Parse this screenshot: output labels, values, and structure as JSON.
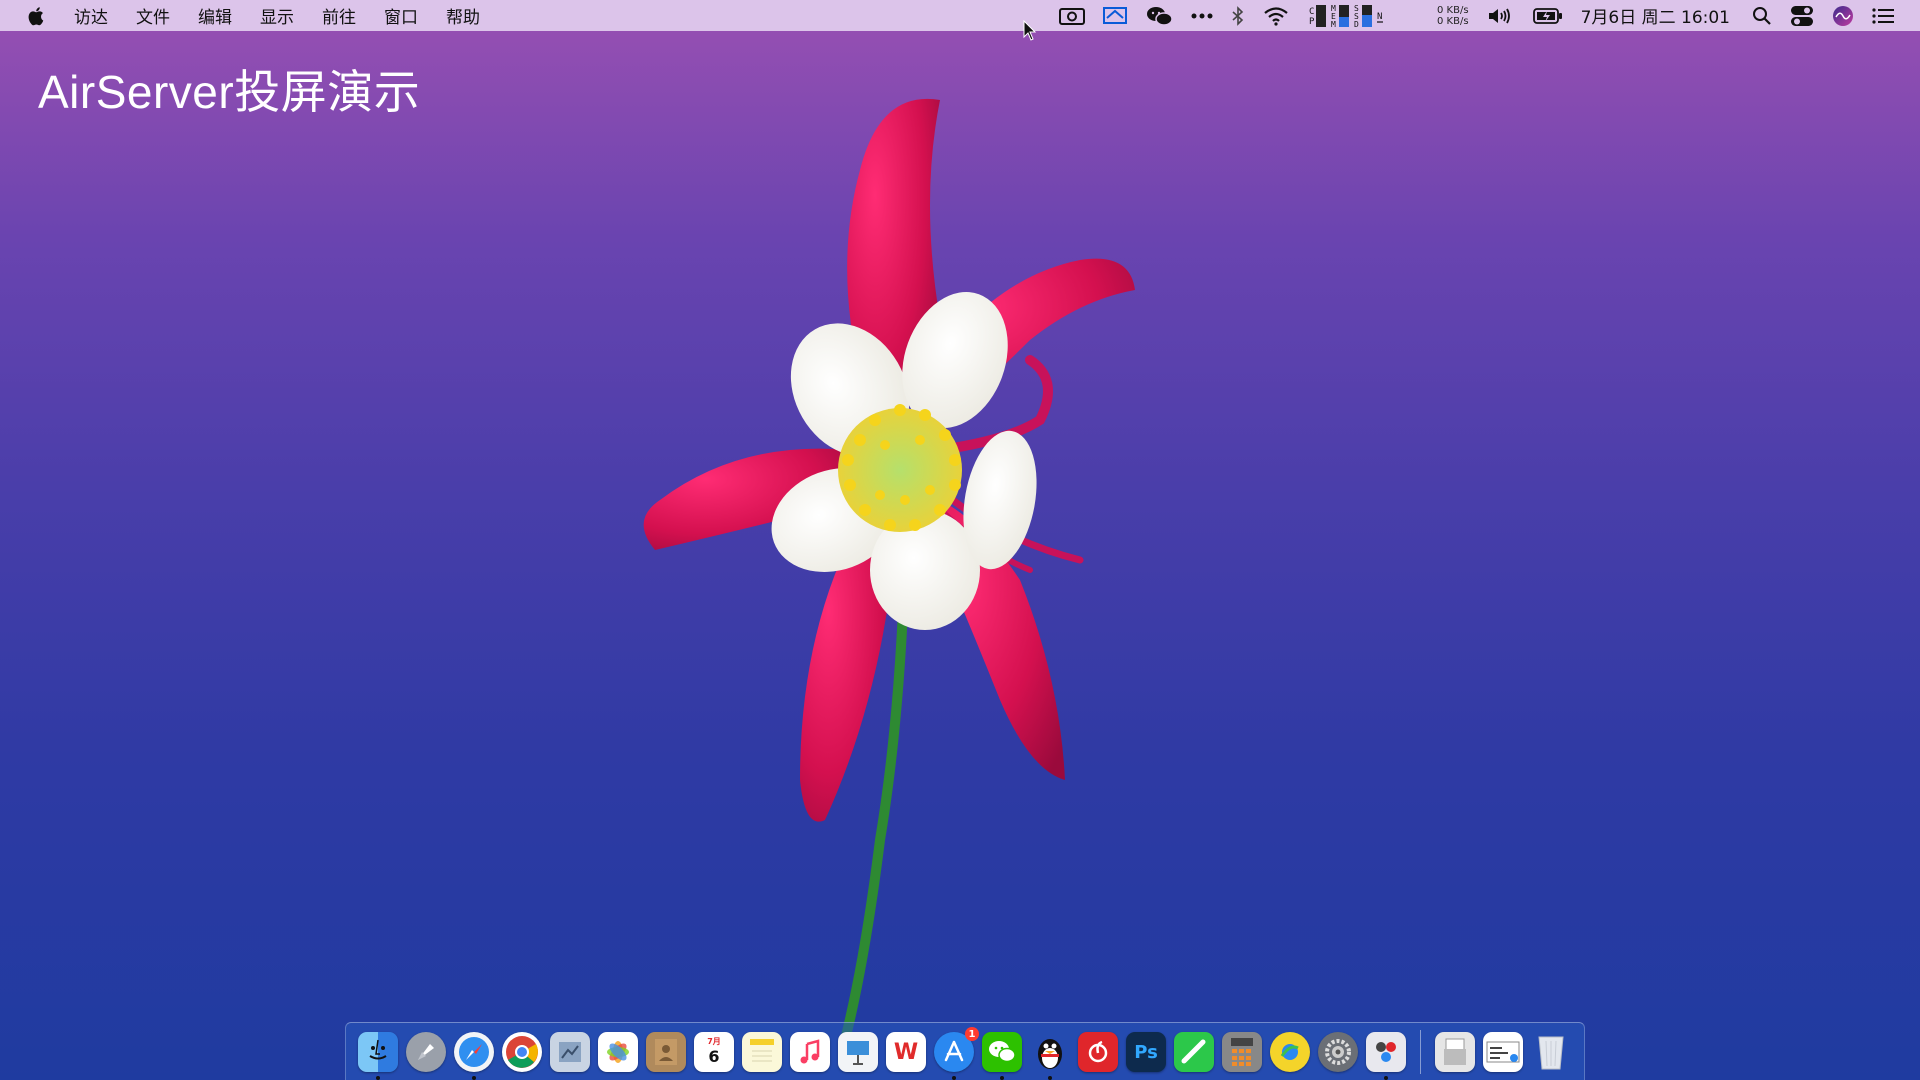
{
  "menubar": {
    "app_menus": [
      "访达",
      "文件",
      "编辑",
      "显示",
      "前往",
      "窗口",
      "帮助"
    ],
    "status_icons": [
      "screen-record-icon",
      "airserver-icon",
      "wechat-icon",
      "more-icon",
      "bluetooth-icon",
      "wifi-icon",
      "cpu-memory-monitor-icon",
      "volume-icon",
      "battery-icon",
      "search-icon",
      "control-center-icon",
      "siri-icon",
      "notification-center-icon"
    ],
    "stats_labels": [
      "C",
      "P",
      "U",
      "M",
      "E",
      "M",
      "S",
      "S",
      "D",
      "N"
    ],
    "net_up": "0 KB/s",
    "net_down": "0 KB/s",
    "clock": "7月6日 周二  16:01"
  },
  "overlay": {
    "title": "AirServer投屏演示"
  },
  "dock": {
    "calendar_month": "7月",
    "calendar_day": "6",
    "appstore_badge": "1",
    "ps_label": "Ps",
    "wps_label": "W",
    "apps": [
      {
        "name": "finder-icon",
        "color": "#3a8ee6",
        "running": true
      },
      {
        "name": "launchpad-icon",
        "color": "#8a8f99",
        "running": false
      },
      {
        "name": "safari-icon",
        "color": "#2f7be0",
        "running": true
      },
      {
        "name": "chrome-icon",
        "color": "#ffffff",
        "running": false
      },
      {
        "name": "preview-icon",
        "color": "#7a8fa8",
        "running": false
      },
      {
        "name": "photos-icon",
        "color": "#ffffff",
        "running": false
      },
      {
        "name": "contacts-icon",
        "color": "#b08a5c",
        "running": false
      },
      {
        "name": "calendar-icon",
        "color": "#ffffff",
        "running": false
      },
      {
        "name": "notes-icon",
        "color": "#f7f3d0",
        "running": false
      },
      {
        "name": "music-icon",
        "color": "#ffffff",
        "running": false
      },
      {
        "name": "keynote-icon",
        "color": "#3b8fd9",
        "running": false
      },
      {
        "name": "wps-icon",
        "color": "#ffffff",
        "running": false
      },
      {
        "name": "app-store-icon",
        "color": "#2a88f0",
        "running": true
      },
      {
        "name": "wechat-icon",
        "color": "#2dc100",
        "running": true
      },
      {
        "name": "qq-icon",
        "color": "#ffffff",
        "running": true
      },
      {
        "name": "netease-music-icon",
        "color": "#e0262b",
        "running": false
      },
      {
        "name": "photoshop-icon",
        "color": "#0d2a4d",
        "running": false
      },
      {
        "name": "facetime-icon",
        "color": "#2cc84a",
        "running": false
      },
      {
        "name": "calculator-icon",
        "color": "#8a8a8a",
        "running": false
      },
      {
        "name": "qq-browser-icon",
        "color": "#f4d42a",
        "running": false
      },
      {
        "name": "system-preferences-icon",
        "color": "#6b6f76",
        "running": false
      },
      {
        "name": "airserver-app-icon",
        "color": "#e8e8ee",
        "running": true
      }
    ],
    "trailing": [
      {
        "name": "documents-stack-icon",
        "color": "#e6e6e6"
      },
      {
        "name": "downloads-stack-icon",
        "color": "#ffffff"
      },
      {
        "name": "trash-icon",
        "color": "#d9dee6"
      }
    ]
  }
}
